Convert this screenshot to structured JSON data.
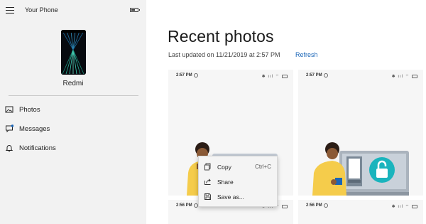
{
  "app": {
    "title": "Your Phone"
  },
  "device": {
    "name": "Redmi"
  },
  "nav": {
    "items": [
      {
        "label": "Photos",
        "icon": "photos-icon",
        "selected": true
      },
      {
        "label": "Messages",
        "icon": "messages-icon"
      },
      {
        "label": "Notifications",
        "icon": "bell-icon"
      }
    ]
  },
  "main": {
    "title": "Recent photos",
    "last_updated": "Last updated on 11/21/2019 at 2:57 PM",
    "refresh_label": "Refresh",
    "photos": [
      {
        "time": "2:57 PM",
        "status": "✱ ııl ⌔"
      },
      {
        "time": "2:57 PM",
        "status": "✱ ııl ⌔"
      },
      {
        "time": "2:56 PM",
        "status": "✱ ııl ⌔"
      },
      {
        "time": "2:56 PM",
        "status": "✱ ııl ⌔"
      }
    ]
  },
  "context_menu": {
    "items": [
      {
        "label": "Copy",
        "shortcut": "Ctrl+C",
        "icon": "copy-icon"
      },
      {
        "label": "Share",
        "icon": "share-icon"
      },
      {
        "label": "Save as...",
        "icon": "save-icon"
      }
    ]
  },
  "colors": {
    "sidebar_bg": "#f2f2f2",
    "link": "#1a65b7",
    "photo_bg": "#f6f6f6",
    "shirt": "#f5cc4b",
    "skin": "#8b5a36",
    "teal": "#1ab4bd"
  }
}
